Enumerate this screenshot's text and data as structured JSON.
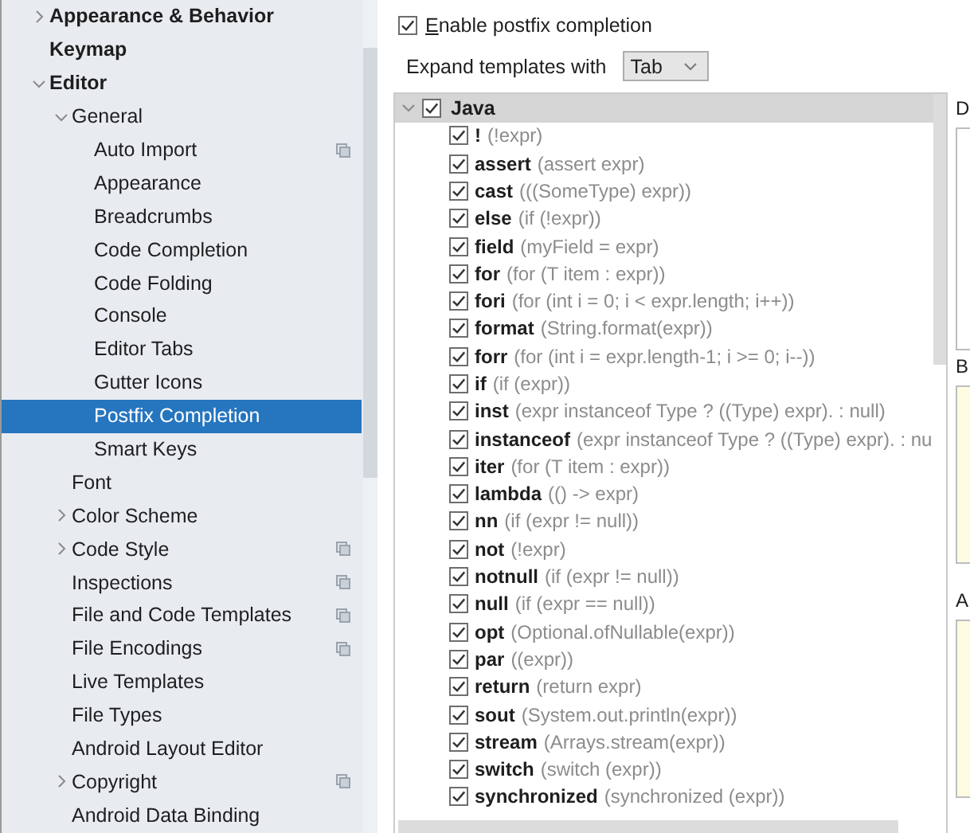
{
  "sidebar": {
    "items": [
      {
        "label": "Appearance & Behavior",
        "kind": "folder",
        "expanded": false,
        "shared": false,
        "selected": false
      },
      {
        "label": "Keymap",
        "kind": "page",
        "shared": false,
        "selected": false
      },
      {
        "label": "Editor",
        "kind": "folder",
        "expanded": true,
        "shared": false,
        "selected": false,
        "children": [
          {
            "label": "General",
            "kind": "folder",
            "expanded": true,
            "shared": false,
            "selected": false,
            "children": [
              {
                "label": "Auto Import",
                "kind": "page",
                "shared": true,
                "selected": false
              },
              {
                "label": "Appearance",
                "kind": "page",
                "shared": false,
                "selected": false
              },
              {
                "label": "Breadcrumbs",
                "kind": "page",
                "shared": false,
                "selected": false
              },
              {
                "label": "Code Completion",
                "kind": "page",
                "shared": false,
                "selected": false
              },
              {
                "label": "Code Folding",
                "kind": "page",
                "shared": false,
                "selected": false
              },
              {
                "label": "Console",
                "kind": "page",
                "shared": false,
                "selected": false
              },
              {
                "label": "Editor Tabs",
                "kind": "page",
                "shared": false,
                "selected": false
              },
              {
                "label": "Gutter Icons",
                "kind": "page",
                "shared": false,
                "selected": false
              },
              {
                "label": "Postfix Completion",
                "kind": "page",
                "shared": false,
                "selected": true
              },
              {
                "label": "Smart Keys",
                "kind": "page",
                "shared": false,
                "selected": false
              }
            ]
          },
          {
            "label": "Font",
            "kind": "page",
            "shared": false,
            "selected": false
          },
          {
            "label": "Color Scheme",
            "kind": "folder",
            "expanded": false,
            "shared": false,
            "selected": false
          },
          {
            "label": "Code Style",
            "kind": "folder",
            "expanded": false,
            "shared": true,
            "selected": false
          },
          {
            "label": "Inspections",
            "kind": "page",
            "shared": true,
            "selected": false
          },
          {
            "label": "File and Code Templates",
            "kind": "page",
            "shared": true,
            "selected": false
          },
          {
            "label": "File Encodings",
            "kind": "page",
            "shared": true,
            "selected": false
          },
          {
            "label": "Live Templates",
            "kind": "page",
            "shared": false,
            "selected": false
          },
          {
            "label": "File Types",
            "kind": "page",
            "shared": false,
            "selected": false
          },
          {
            "label": "Android Layout Editor",
            "kind": "page",
            "shared": false,
            "selected": false
          },
          {
            "label": "Copyright",
            "kind": "folder",
            "expanded": false,
            "shared": true,
            "selected": false
          },
          {
            "label": "Android Data Binding",
            "kind": "page",
            "shared": false,
            "selected": false
          }
        ]
      }
    ]
  },
  "enable": {
    "label": "Enable postfix completion",
    "checked": true
  },
  "expand": {
    "label": "Expand templates with",
    "value": "Tab"
  },
  "templates": {
    "group": {
      "label": "Java",
      "checked": true,
      "expanded": true
    },
    "items": [
      {
        "name": "!",
        "example": "(!expr)",
        "checked": true
      },
      {
        "name": "assert",
        "example": "(assert expr)",
        "checked": true
      },
      {
        "name": "cast",
        "example": "(((SomeType) expr))",
        "checked": true
      },
      {
        "name": "else",
        "example": "(if (!expr))",
        "checked": true
      },
      {
        "name": "field",
        "example": "(myField = expr)",
        "checked": true
      },
      {
        "name": "for",
        "example": "(for (T item : expr))",
        "checked": true
      },
      {
        "name": "fori",
        "example": "(for (int i = 0; i < expr.length; i++))",
        "checked": true
      },
      {
        "name": "format",
        "example": "(String.format(expr))",
        "checked": true
      },
      {
        "name": "forr",
        "example": "(for (int i = expr.length-1; i >= 0; i--))",
        "checked": true
      },
      {
        "name": "if",
        "example": "(if (expr))",
        "checked": true
      },
      {
        "name": "inst",
        "example": "(expr instanceof Type ? ((Type) expr). : null)",
        "checked": true
      },
      {
        "name": "instanceof",
        "example": "(expr instanceof Type ? ((Type) expr). : nu",
        "checked": true
      },
      {
        "name": "iter",
        "example": "(for (T item : expr))",
        "checked": true
      },
      {
        "name": "lambda",
        "example": "(() -> expr)",
        "checked": true
      },
      {
        "name": "nn",
        "example": "(if (expr != null))",
        "checked": true
      },
      {
        "name": "not",
        "example": "(!expr)",
        "checked": true
      },
      {
        "name": "notnull",
        "example": "(if (expr != null))",
        "checked": true
      },
      {
        "name": "null",
        "example": "(if (expr == null))",
        "checked": true
      },
      {
        "name": "opt",
        "example": "(Optional.ofNullable(expr))",
        "checked": true
      },
      {
        "name": "par",
        "example": "((expr))",
        "checked": true
      },
      {
        "name": "return",
        "example": "(return expr)",
        "checked": true
      },
      {
        "name": "sout",
        "example": "(System.out.println(expr))",
        "checked": true
      },
      {
        "name": "stream",
        "example": "(Arrays.stream(expr))",
        "checked": true
      },
      {
        "name": "switch",
        "example": "(switch (expr))",
        "checked": true
      },
      {
        "name": "synchronized",
        "example": "(synchronized (expr))",
        "checked": true
      }
    ]
  },
  "side_panel": {
    "sections": [
      {
        "label": "D",
        "kind": "text"
      },
      {
        "label": "B",
        "kind": "code"
      },
      {
        "label": "A",
        "kind": "code"
      }
    ]
  }
}
